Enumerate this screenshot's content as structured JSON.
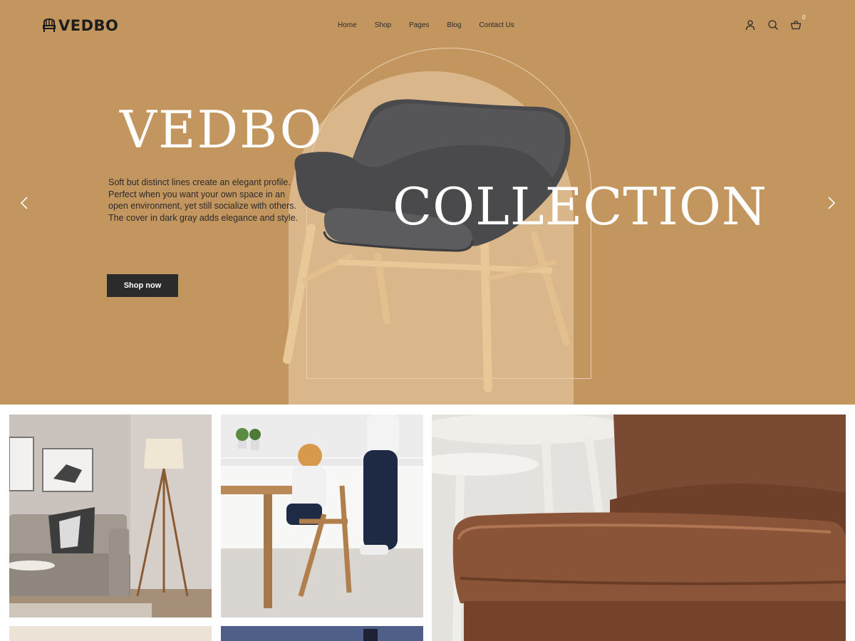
{
  "brand": {
    "name": "VEDBO"
  },
  "nav": {
    "items": [
      "Home",
      "Shop",
      "Pages",
      "Blog",
      "Contact Us"
    ]
  },
  "header_icons": [
    "user-icon",
    "search-icon",
    "cart-icon"
  ],
  "cart": {
    "count": "0"
  },
  "hero": {
    "title_line1": "VEDBO",
    "title_line2": "COLLECTION",
    "description": "Soft but distinct lines create an elegant profile. Perfect when you want your own space in an open environment, yet still socialize with others. The cover in dark gray adds elegance and style.",
    "cta_label": "Shop now",
    "prev_icon": "chevron-left-icon",
    "next_icon": "chevron-right-icon"
  },
  "colors": {
    "hero_bg": "#c4965f",
    "arch": "#dab78a",
    "button": "#2b2b2b"
  },
  "gallery": {
    "tiles": [
      "living-room-image",
      "kids-chair-image",
      "leather-ottoman-image",
      "light-room-image",
      "dark-blue-image"
    ]
  }
}
